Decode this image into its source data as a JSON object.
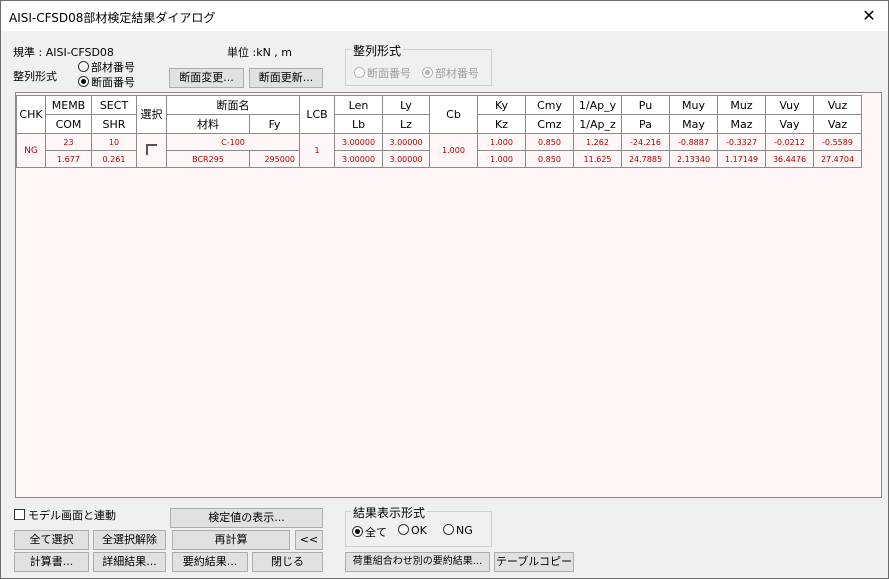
{
  "window": {
    "title": "AISI-CFSD08部材検定結果ダイアログ",
    "close_glyph": "✕"
  },
  "top": {
    "standard": "規準 : AISI-CFSD08",
    "unit": "単位 :kN  ,  m",
    "sort_label": "整列形式",
    "sort_opt1": "部材番号",
    "sort_opt2": "断面番号",
    "btn_change": "断面変更...",
    "btn_update": "断面更新...",
    "group2_title": "整列形式",
    "g2_opt1": "断面番号",
    "g2_opt2": "部材番号"
  },
  "table": {
    "h1": [
      "CHK",
      "MEMB",
      "SECT",
      "選択",
      "断面名",
      "LCB",
      "Len",
      "Ly",
      "Cb",
      "Ky",
      "Cmy",
      "1/Ap_y",
      "Pu",
      "Muy",
      "Muz",
      "Vuy",
      "Vuz"
    ],
    "h2": [
      "COM",
      "SHR",
      "材料",
      "Fy",
      "Lb",
      "Lz",
      "Kz",
      "Cmz",
      "1/Ap_z",
      "Pa",
      "May",
      "Maz",
      "Vay",
      "Vaz"
    ],
    "rows": [
      {
        "chk": "NG",
        "memb": "23",
        "sect": "10",
        "sect_name": "C-100",
        "lcb": "1",
        "len": "3.00000",
        "ly": "3.00000",
        "cb": "1.000",
        "ky": "1.000",
        "cmy": "0.850",
        "apy": "1.262",
        "pu": "-24.216",
        "muy": "-0.8887",
        "muz": "-0.3327",
        "vuy": "-0.0212",
        "vuz": "-0.5589",
        "com": "1.677",
        "shr": "0.261",
        "material": "BCR295",
        "fy": "295000",
        "lb": "3.00000",
        "lz": "3.00000",
        "kz": "1.000",
        "cmz": "0.850",
        "apz": "11.625",
        "pa": "24.7885",
        "may": "2.13340",
        "maz": "1.17149",
        "vay": "36.4476",
        "vaz": "27.4704"
      }
    ]
  },
  "bottom": {
    "link_model": "モデル画面と連動",
    "btn_show": "検定値の表示...",
    "btn_select_all": "全て選択",
    "btn_deselect_all": "全選択解除",
    "btn_recalc": "再計算",
    "btn_back": "<<",
    "btn_calc_book": "計算書...",
    "btn_detail": "詳細結果...",
    "btn_summary": "要約結果...",
    "btn_close": "閉じる",
    "group_title": "結果表示形式",
    "opt_all": "全て",
    "opt_ok": "OK",
    "opt_ng": "NG",
    "btn_load_combo": "荷重組合わせ別の要約結果...",
    "btn_table_copy": "テーブルコピー"
  }
}
